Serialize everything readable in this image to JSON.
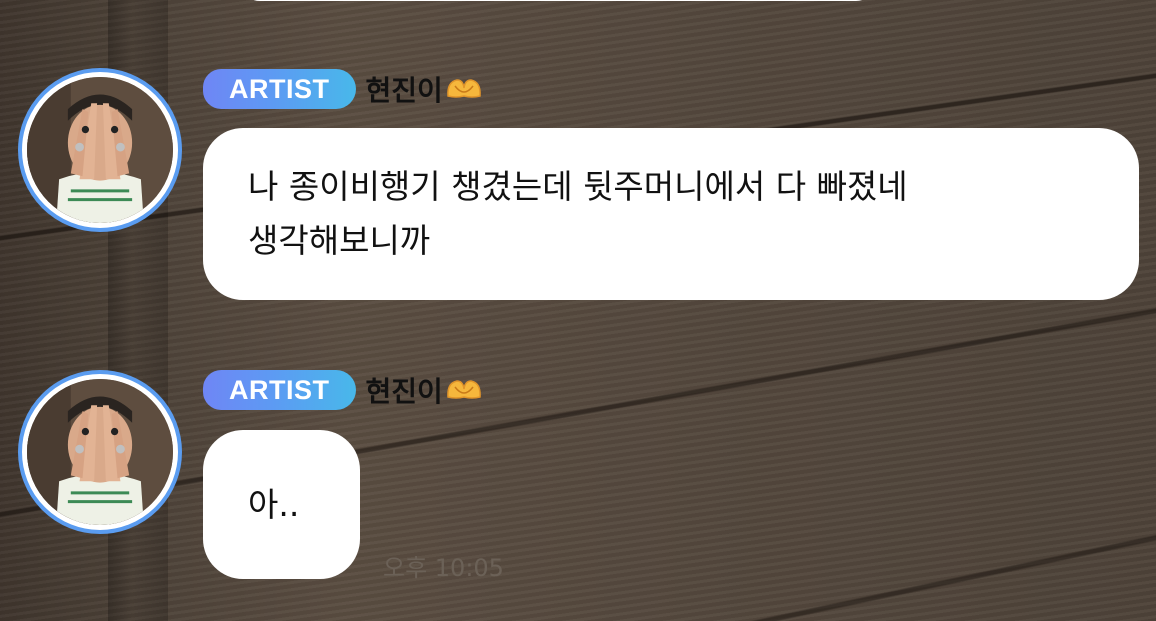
{
  "messages": [
    {
      "badge": "ARTIST",
      "sender": "현진이",
      "sender_emoji": "heart-hands-icon",
      "lines": [
        "나 종이비행기 챙겼는데 뒷주머니에서 다 빠졌네",
        "생각해보니까"
      ]
    },
    {
      "badge": "ARTIST",
      "sender": "현진이",
      "sender_emoji": "heart-hands-icon",
      "lines": [
        "아.."
      ],
      "time": "오후 10:05"
    }
  ],
  "colors": {
    "badge_gradient_start": "#6f86f5",
    "badge_gradient_end": "#48b8ea",
    "avatar_ring": "#5a9cf0",
    "bubble_bg": "#ffffff",
    "background": "#54483d"
  }
}
